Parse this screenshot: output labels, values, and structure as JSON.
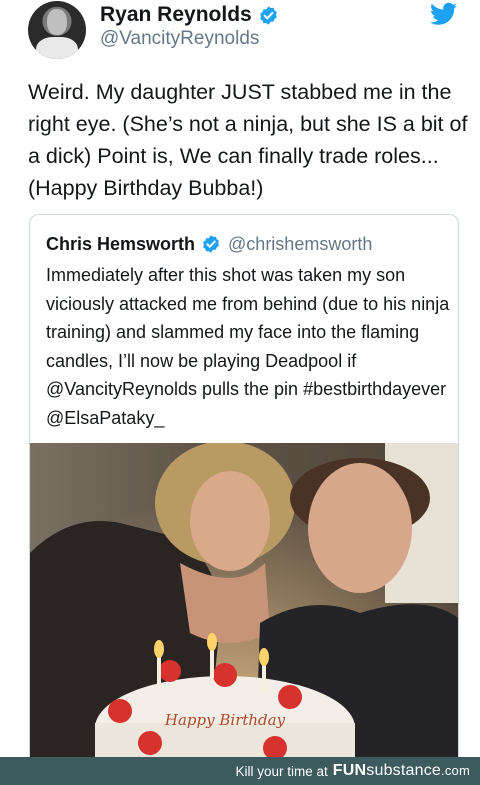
{
  "tweet": {
    "author_name": "Ryan Reynolds",
    "author_handle": "@VancityReynolds",
    "text": "Weird. My daughter JUST stabbed me in the right eye. (She’s not a ninja, but she IS a bit of a dick) Point is, We can finally trade roles... (Happy Birthday Bubba!)"
  },
  "quoted": {
    "author_name": "Chris Hemsworth",
    "author_handle": "@chrishemsworth",
    "text": "Immediately after this shot was taken my son viciously attacked me from behind (due to his ninja training) and slammed my face into the flaming candles, I’ll now be playing Deadpool if  @VancityReynolds pulls the pin #bestbirthdayever @ElsaPataky_",
    "cake_text": "Happy Birthday"
  },
  "footer": {
    "prefix": "Kill your time at",
    "brand_a": "FUN",
    "brand_b": "substance",
    "brand_c": ".com"
  },
  "colors": {
    "verified_blue": "#1da1f2",
    "twitter_blue": "#1da1f2",
    "footer_bg": "#3d5a5e",
    "handle_gray": "#657786"
  },
  "icons": [
    "verified-badge-icon",
    "twitter-bird-icon"
  ]
}
